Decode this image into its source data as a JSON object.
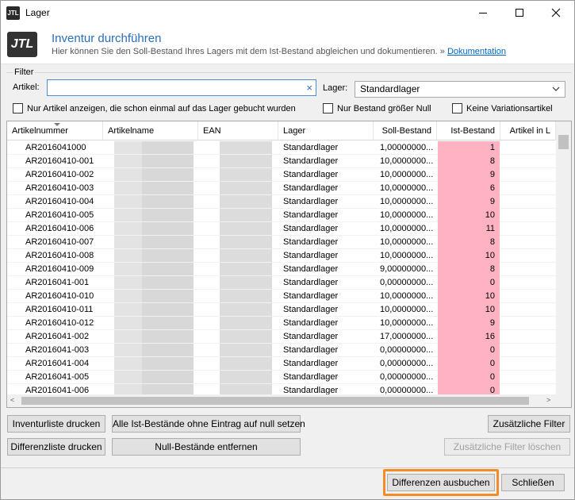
{
  "window": {
    "title": "Lager",
    "app_icon": "JTL",
    "buttons": [
      "minimize-icon",
      "maximize-icon",
      "close-icon"
    ]
  },
  "header": {
    "logo": "JTL",
    "title": "Inventur durchführen",
    "subtitle": "Hier können Sie den Soll-Bestand Ihres Lagers mit dem Ist-Bestand abgleichen und dokumentieren. »",
    "doc_link": "Dokumentation"
  },
  "filter": {
    "legend": "Filter",
    "artikel_label": "Artikel:",
    "artikel_value": "",
    "lager_label": "Lager:",
    "lager_value": "Standardlager",
    "checkboxes": [
      {
        "label": "Nur Artikel anzeigen, die schon einmal auf das Lager gebucht wurden",
        "checked": false
      },
      {
        "label": "Nur Bestand größer Null",
        "checked": false
      },
      {
        "label": "Keine Variationsartikel",
        "checked": false
      }
    ]
  },
  "table": {
    "columns": [
      "Artikelnummer",
      "Artikelname",
      "EAN",
      "Lager",
      "Soll-Bestand",
      "Ist-Bestand",
      "Artikel in L"
    ],
    "rows": [
      {
        "nr": "AR2016041000",
        "lager": "Standardlager",
        "soll": "1,00000000...",
        "ist": "1"
      },
      {
        "nr": "AR20160410-001",
        "lager": "Standardlager",
        "soll": "10,0000000...",
        "ist": "8"
      },
      {
        "nr": "AR20160410-002",
        "lager": "Standardlager",
        "soll": "10,0000000...",
        "ist": "9"
      },
      {
        "nr": "AR20160410-003",
        "lager": "Standardlager",
        "soll": "10,0000000...",
        "ist": "6"
      },
      {
        "nr": "AR20160410-004",
        "lager": "Standardlager",
        "soll": "10,0000000...",
        "ist": "9"
      },
      {
        "nr": "AR20160410-005",
        "lager": "Standardlager",
        "soll": "10,0000000...",
        "ist": "10"
      },
      {
        "nr": "AR20160410-006",
        "lager": "Standardlager",
        "soll": "10,0000000...",
        "ist": "11"
      },
      {
        "nr": "AR20160410-007",
        "lager": "Standardlager",
        "soll": "10,0000000...",
        "ist": "8"
      },
      {
        "nr": "AR20160410-008",
        "lager": "Standardlager",
        "soll": "10,0000000...",
        "ist": "10"
      },
      {
        "nr": "AR20160410-009",
        "lager": "Standardlager",
        "soll": "9,00000000...",
        "ist": "8"
      },
      {
        "nr": "AR2016041-001",
        "lager": "Standardlager",
        "soll": "0,00000000...",
        "ist": "0"
      },
      {
        "nr": "AR20160410-010",
        "lager": "Standardlager",
        "soll": "10,0000000...",
        "ist": "10"
      },
      {
        "nr": "AR20160410-011",
        "lager": "Standardlager",
        "soll": "10,0000000...",
        "ist": "10"
      },
      {
        "nr": "AR20160410-012",
        "lager": "Standardlager",
        "soll": "10,0000000...",
        "ist": "9"
      },
      {
        "nr": "AR2016041-002",
        "lager": "Standardlager",
        "soll": "17,0000000...",
        "ist": "16"
      },
      {
        "nr": "AR2016041-003",
        "lager": "Standardlager",
        "soll": "0,00000000...",
        "ist": "0"
      },
      {
        "nr": "AR2016041-004",
        "lager": "Standardlager",
        "soll": "0,00000000...",
        "ist": "0"
      },
      {
        "nr": "AR2016041-005",
        "lager": "Standardlager",
        "soll": "0,00000000...",
        "ist": "0"
      },
      {
        "nr": "AR2016041-006",
        "lager": "Standardlager",
        "soll": "0,00000000...",
        "ist": "0"
      }
    ]
  },
  "buttons": {
    "inventurliste": "Inventurliste drucken",
    "alle_null": "Alle Ist-Bestände ohne Eintrag auf null setzen",
    "zus_filter": "Zusätzliche Filter",
    "differenzliste": "Differenzliste drucken",
    "null_entfernen": "Null-Bestände entfernen",
    "zus_filter_loeschen": "Zusätzliche Filter löschen",
    "differenzen": "Differenzen ausbuchen",
    "schliessen": "Schließen"
  },
  "colors": {
    "accent": "#2a6ebb",
    "ist_cell": "#ffb3c2",
    "highlight": "#f28c28"
  }
}
